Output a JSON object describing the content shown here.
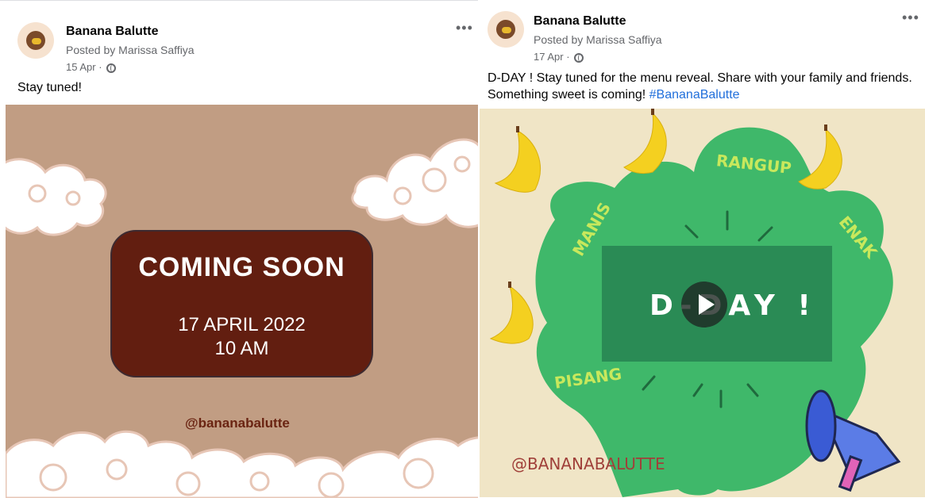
{
  "posts": [
    {
      "page_name": "Banana Balutte",
      "posted_by": "Posted by Marissa Saffiya",
      "date": "15 Apr",
      "separator": "·",
      "more_label": "•••",
      "caption": "Stay tuned!",
      "image": {
        "headline": "COMING SOON",
        "date": "17 APRIL 2022",
        "time": "10 AM",
        "handle": "@bananabalutte",
        "colors": {
          "background": "#c19d83",
          "box": "#621e10",
          "handle": "#6a2412"
        }
      }
    },
    {
      "page_name": "Banana Balutte",
      "posted_by": "Posted by Marissa Saffiya",
      "date": "17 Apr",
      "separator": "·",
      "more_label": "•••",
      "caption_line1": "D-DAY ! Stay tuned for the menu reveal. Share with your family and friends.",
      "caption_line2": "Something sweet is coming! ",
      "hashtag": "#BananaBalutte",
      "image": {
        "headline": "D-DAY !",
        "words": {
          "rangup": "RANGUP",
          "manis": "MANIS",
          "enak": "ENAK",
          "pisang": "PISANG"
        },
        "handle": "@BANANABALUTTE",
        "colors": {
          "background": "#f0e5c6",
          "blob": "#3fb86a",
          "panel": "#2a8b55",
          "word": "#c8e85c"
        }
      }
    }
  ]
}
